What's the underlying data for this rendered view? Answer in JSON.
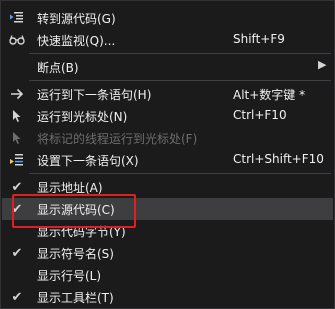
{
  "menu": {
    "items": [
      {
        "label": "转到源代码(G)",
        "shortcut": "",
        "icon": "goto-source-icon"
      },
      {
        "label": "快速监视(Q)...",
        "shortcut": "Shift+F9",
        "icon": "glasses-icon"
      },
      {
        "label": "断点(B)",
        "shortcut": "",
        "icon": "",
        "submenu": true
      },
      {
        "label": "运行到下一条语句(H)",
        "shortcut": "Alt+数字键 *",
        "icon": "arrow-right-icon"
      },
      {
        "label": "运行到光标处(N)",
        "shortcut": "Ctrl+F10",
        "icon": "cursor-icon"
      },
      {
        "label": "将标记的线程运行到光标处(F)",
        "shortcut": "",
        "icon": "cursor-icon",
        "disabled": true
      },
      {
        "label": "设置下一条语句(X)",
        "shortcut": "Ctrl+Shift+F10",
        "icon": "set-next-statement-icon"
      },
      {
        "label": "显示地址(A)",
        "shortcut": "",
        "icon": "check-icon",
        "checked": true
      },
      {
        "label": "显示源代码(C)",
        "shortcut": "",
        "icon": "check-icon",
        "checked": true,
        "highlighted": true
      },
      {
        "label": "显示代码字节(Y)",
        "shortcut": "",
        "icon": ""
      },
      {
        "label": "显示符号名(S)",
        "shortcut": "",
        "icon": "check-icon",
        "checked": true
      },
      {
        "label": "显示行号(L)",
        "shortcut": "",
        "icon": ""
      },
      {
        "label": "显示工具栏(T)",
        "shortcut": "",
        "icon": "check-icon",
        "checked": true
      }
    ],
    "check_glyph": "✔",
    "submenu_arrow": "▶"
  },
  "colors": {
    "background": "#1b1b1c",
    "highlight": "#3e3e40",
    "text": "#f1f1f1",
    "disabled_text": "#6d6d6d",
    "annotation": "#e02020"
  }
}
